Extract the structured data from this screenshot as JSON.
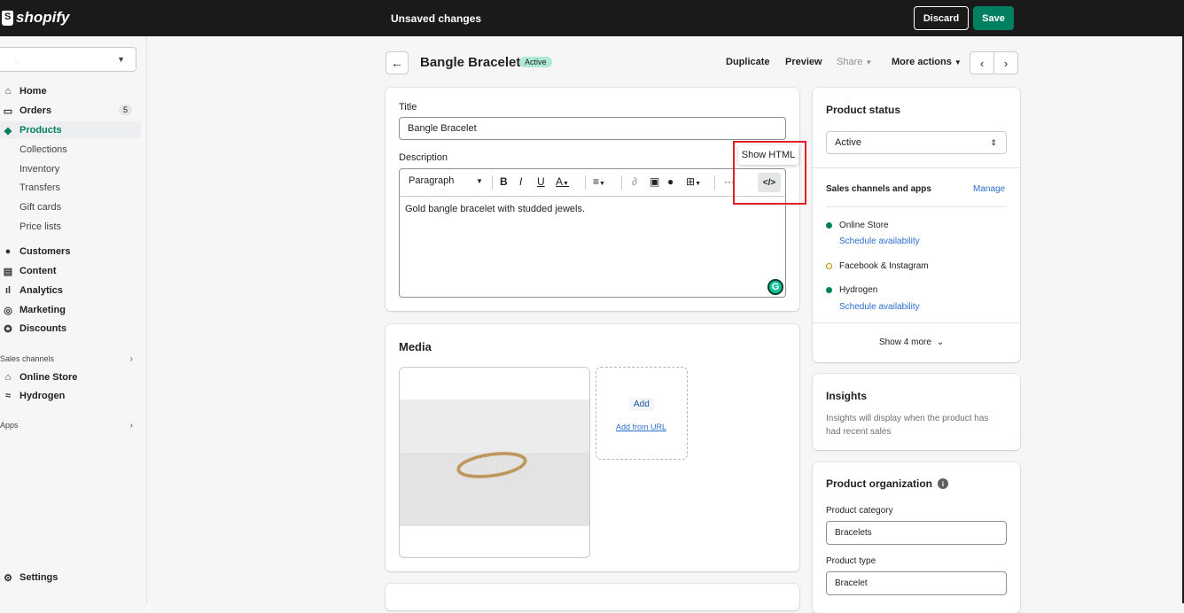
{
  "topbar": {
    "logo": "shopify",
    "title": "Unsaved changes",
    "discard": "Discard",
    "save": "Save"
  },
  "sidebar": {
    "store_value": ".",
    "items": [
      {
        "label": "Home",
        "icon": "home-icon"
      },
      {
        "label": "Orders",
        "icon": "orders-icon",
        "badge": "5"
      },
      {
        "label": "Products",
        "icon": "tag-icon"
      },
      {
        "label": "Customers",
        "icon": "person-icon"
      },
      {
        "label": "Content",
        "icon": "content-icon"
      },
      {
        "label": "Analytics",
        "icon": "analytics-icon"
      },
      {
        "label": "Marketing",
        "icon": "marketing-icon"
      },
      {
        "label": "Discounts",
        "icon": "discount-icon"
      },
      {
        "label": "Online Store",
        "icon": "store-icon"
      },
      {
        "label": "Hydrogen",
        "icon": "hydrogen-icon"
      },
      {
        "label": "Settings",
        "icon": "gear-icon"
      }
    ],
    "subitems": [
      "Collections",
      "Inventory",
      "Transfers",
      "Gift cards",
      "Price lists"
    ],
    "sections": {
      "sales_channels": "Sales channels",
      "apps": "Apps"
    }
  },
  "header": {
    "title": "Bangle Bracelet",
    "status_badge": "Active",
    "duplicate": "Duplicate",
    "preview": "Preview",
    "share": "Share",
    "more_actions": "More actions"
  },
  "product": {
    "title_label": "Title",
    "title_value": "Bangle Bracelet",
    "description_label": "Description",
    "paragraph": "Paragraph",
    "tooltip": "Show HTML",
    "description_text": "Gold bangle bracelet with studded jewels."
  },
  "media": {
    "title": "Media",
    "add": "Add",
    "add_from_url": "Add from URL"
  },
  "status": {
    "title": "Product status",
    "value": "Active",
    "channels_title": "Sales channels and apps",
    "manage": "Manage",
    "channels": [
      {
        "name": "Online Store",
        "link": "Schedule availability"
      },
      {
        "name": "Facebook & Instagram"
      },
      {
        "name": "Hydrogen",
        "link": "Schedule availability"
      }
    ],
    "show_more": "Show 4 more"
  },
  "insights": {
    "title": "Insights",
    "text": "Insights will display when the product has had recent sales"
  },
  "organization": {
    "title": "Product organization",
    "category_label": "Product category",
    "category_value": "Bracelets",
    "type_label": "Product type",
    "type_value": "Bracelet"
  },
  "colors": {
    "save": "#008060",
    "link": "#2c6ecb",
    "topbar": "#1a1a1a",
    "highlight": "#e01f26"
  }
}
